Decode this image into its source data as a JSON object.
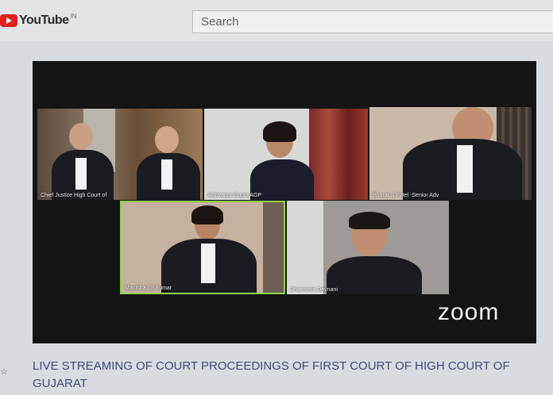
{
  "header": {
    "logo_text": "YouTube",
    "region": "IN",
    "search_placeholder": "Search"
  },
  "participants": [
    {
      "name": "Chief Justice High Court of"
    },
    {
      "name": "Aishvarya Gupta AGP"
    },
    {
      "name": "Bharat S Patel -Senior Adv"
    },
    {
      "name": "Manisha Lovkumar"
    },
    {
      "name": "Dharmesh Devnani"
    }
  ],
  "player": {
    "brand": "zoom",
    "active_speaker_color": "#8fd14f"
  },
  "video": {
    "title": "LIVE STREAMING OF COURT PROCEEDINGS OF FIRST COURT OF HIGH COURT OF GUJARAT"
  }
}
